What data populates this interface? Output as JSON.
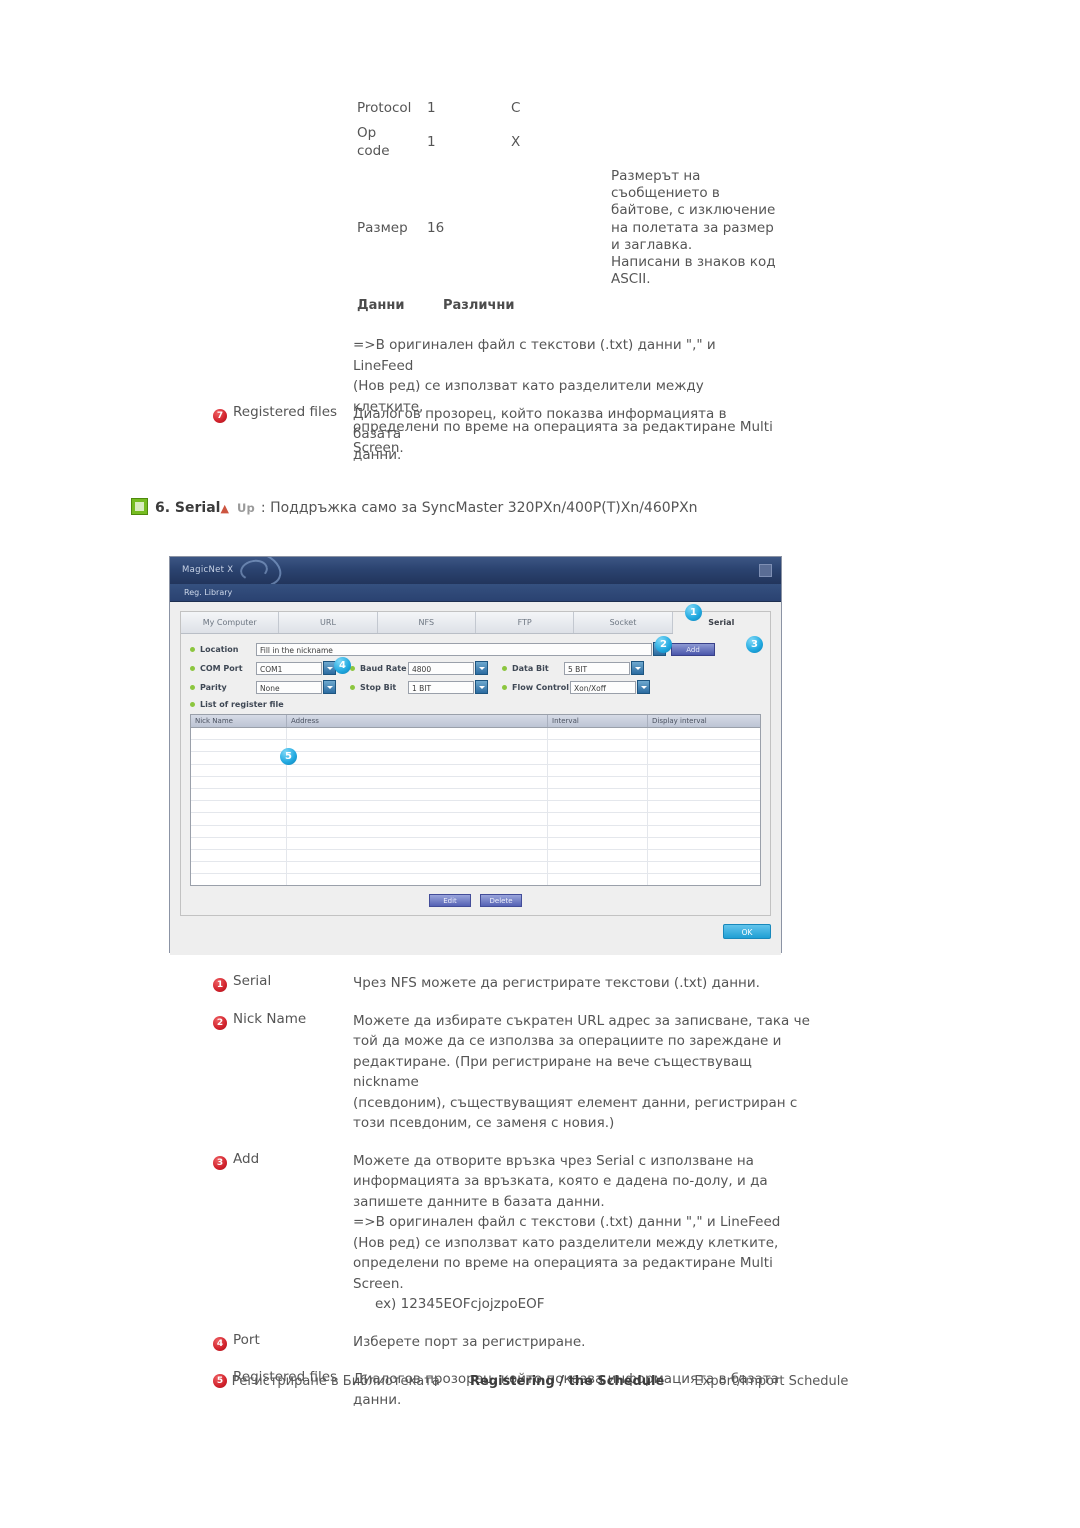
{
  "spec_table": {
    "rows": [
      {
        "name": "Protocol",
        "len": "1",
        "val": "C",
        "desc": ""
      },
      {
        "name": "Op\ncode",
        "len": "1",
        "val": "X",
        "desc": ""
      },
      {
        "name": "Размер",
        "len": "16",
        "val": "",
        "desc": "Размерът на\nсъобщението в\nбайтове, с изключение\nна полетата за размер\nи заглавка.\nНаписани в знаков код\nASCII."
      }
    ]
  },
  "data_row": {
    "label1": "Данни",
    "label2": "Различни"
  },
  "note_block": {
    "text": "=>В оригинален файл с текстови (.txt) данни \",\" и LineFeed\n(Нов ред) се използват като разделители между клетките,\nопределени по време на операцията за редактиране Multi\nScreen."
  },
  "registered_files_row": {
    "number": "7",
    "label": "Registered files",
    "desc": "Диалогов прозорец, който показва информацията в базата\nданни."
  },
  "section_heading": {
    "icon": "green-square-icon",
    "title": "6. Serial",
    "up_arrow": "▲",
    "up_label": "Up",
    "text": ": Поддръжка само за SyncMaster 320PXn/400P(T)Xn/460PXn"
  },
  "dialog": {
    "title": "MagicNet X",
    "subtitle": "Reg. Library",
    "close_icon": "close-icon",
    "tabs": [
      {
        "label": "My Computer",
        "active": false
      },
      {
        "label": "URL",
        "active": false
      },
      {
        "label": "NFS",
        "active": false
      },
      {
        "label": "FTP",
        "active": false
      },
      {
        "label": "Socket",
        "active": false
      },
      {
        "label": "Serial",
        "active": true
      }
    ],
    "fields": {
      "location_label": "Location",
      "location_value": "Fill in the nickname",
      "add_label": "Add",
      "com_port_label": "COM Port",
      "com_port_value": "COM1",
      "baud_rate_label": "Baud Rate",
      "baud_rate_value": "4800",
      "data_bit_label": "Data Bit",
      "data_bit_value": "5 BIT",
      "parity_label": "Parity",
      "parity_value": "None",
      "stop_bit_label": "Stop Bit",
      "stop_bit_value": "1 BIT",
      "flow_control_label": "Flow Control",
      "flow_control_value": "Xon/Xoff"
    },
    "list_label": "List of register file",
    "table": {
      "columns": [
        "Nick Name",
        "Address",
        "Interval",
        "Display interval"
      ],
      "rows": []
    },
    "buttons": {
      "edit": "Edit",
      "delete": "Delete",
      "ok": "OK"
    },
    "callouts": [
      "1",
      "2",
      "3",
      "4",
      "5"
    ]
  },
  "legend": {
    "items": [
      {
        "number": "1",
        "label": "Serial",
        "desc": "Чрез NFS можете да регистрирате текстови (.txt) данни."
      },
      {
        "number": "2",
        "label": "Nick Name",
        "desc": "Можете да избирате съкратен URL адрес за записване, така че\nтой да може да се използва за операциите по зареждане и\nредактиране. (При регистриране на вече съществуващ nickname\n(псевдоним), съществуващият елемент данни, регистриран с\nтози псевдоним, се заменя с новия.)"
      },
      {
        "number": "3",
        "label": "Add",
        "desc": "Можете да отворите връзка чрез Serial с използване на\nинформацията за връзката, която е дадена по-долу, и да\nзапишете данните в базата данни.\n=>В оригинален файл с текстови (.txt) данни \",\" и LineFeed\n(Нов ред) се използват като разделители между клетките,\nопределени по време на операцията за редактиране Multi\nScreen.",
        "example": "ex) 12345EOFcjojzpoEOF"
      },
      {
        "number": "4",
        "label": "Port",
        "desc": "Изберете порт за регистриране."
      },
      {
        "number": "5",
        "label": "Registered files",
        "desc": "Диалогов прозорец, който показва информацията в базата\nданни."
      }
    ]
  },
  "page_footer": {
    "links": [
      {
        "label": "Регистриране в Библиотеката",
        "current": false
      },
      {
        "label": "Registering / the Schedule",
        "current": true
      },
      {
        "label": "Export/Import Schedule",
        "current": false
      }
    ]
  }
}
